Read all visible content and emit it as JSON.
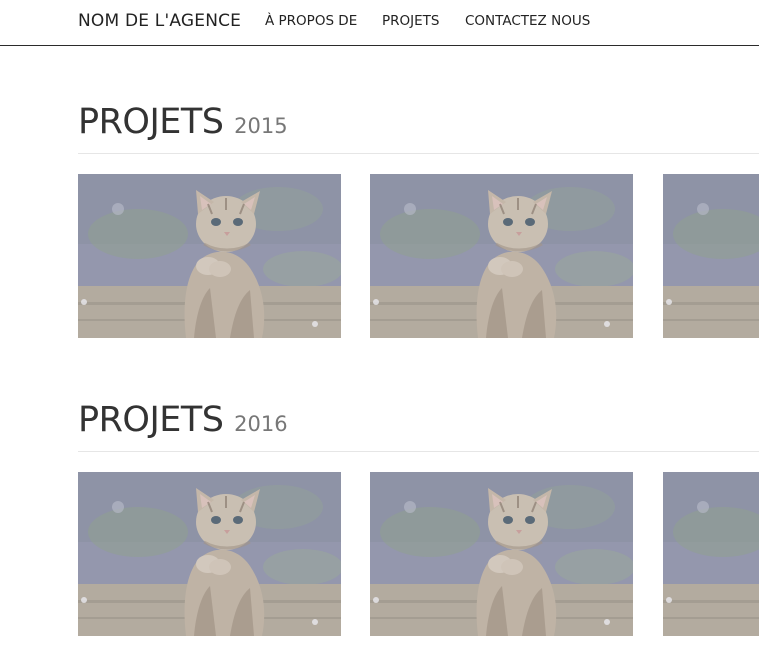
{
  "navbar": {
    "brand": "NOM DE L'AGENCE",
    "links": [
      {
        "label": "À PROPOS DE"
      },
      {
        "label": "PROJETS"
      },
      {
        "label": "CONTACTEZ NOUS"
      }
    ]
  },
  "sections": [
    {
      "title": "PROJETS",
      "year": "2015",
      "items": [
        {
          "image": "kitten-photo"
        },
        {
          "image": "kitten-photo"
        },
        {
          "image": "kitten-photo"
        }
      ]
    },
    {
      "title": "PROJETS",
      "year": "2016",
      "items": [
        {
          "image": "kitten-photo"
        },
        {
          "image": "kitten-photo"
        },
        {
          "image": "kitten-photo"
        }
      ]
    }
  ],
  "colors": {
    "text": "#333333",
    "year": "#777777",
    "nav_border": "#2b2b2b",
    "photo_tint": "#8e92a8"
  }
}
